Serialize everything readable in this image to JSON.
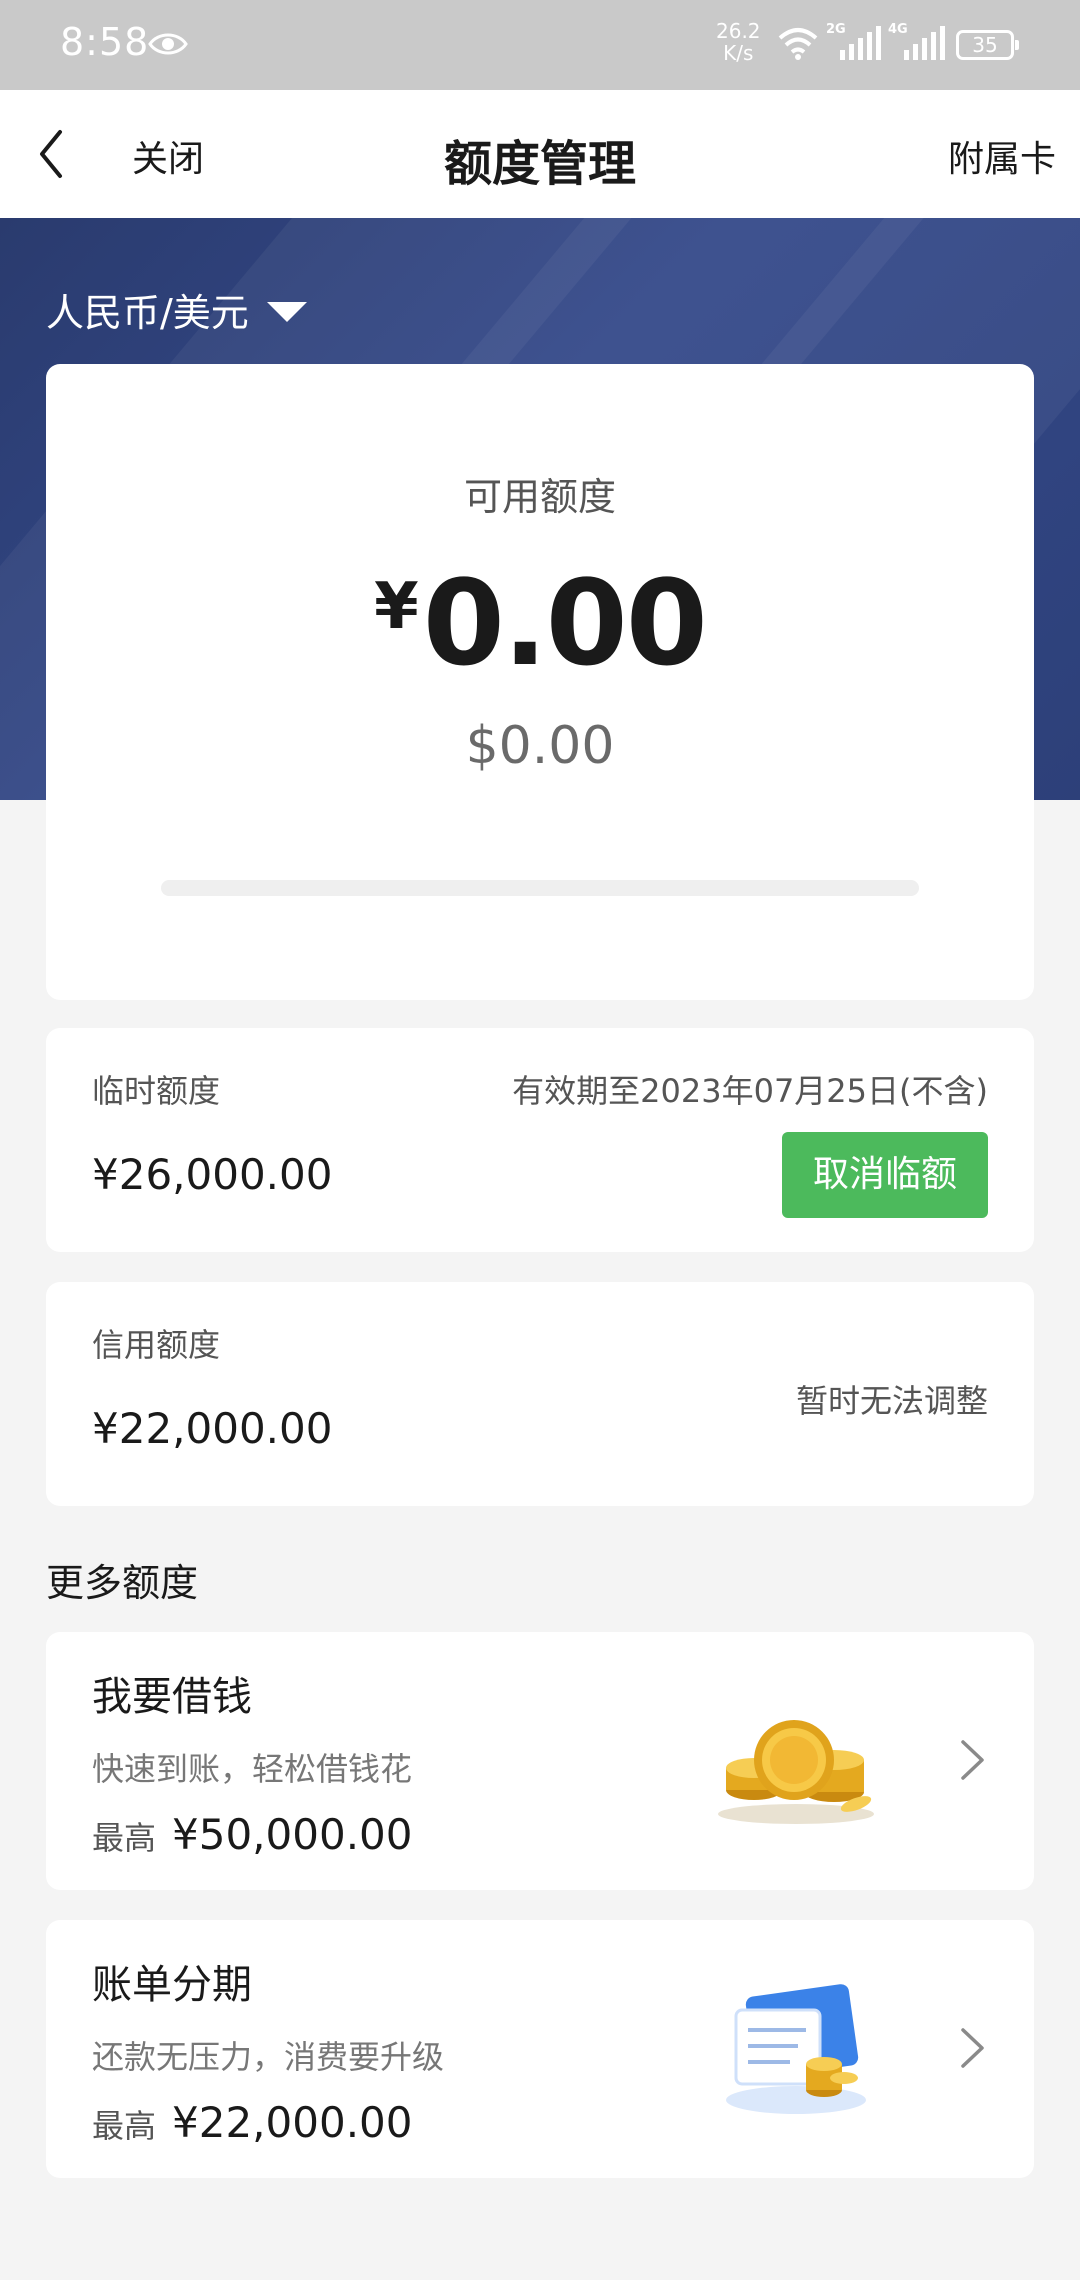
{
  "status_bar": {
    "time": "8:58",
    "net_speed_value": "26.2",
    "net_speed_unit": "K/s",
    "sig1_tag": "2G",
    "sig2_tag": "4G",
    "battery": "35"
  },
  "nav": {
    "close": "关闭",
    "title": "额度管理",
    "right": "附属卡"
  },
  "currency_selector": "人民币/美元",
  "available": {
    "label": "可用额度",
    "symbol": "¥",
    "value": "0.00",
    "usd": "$0.00",
    "usage_fraction": 0
  },
  "temporary": {
    "label": "临时额度",
    "expiry": "有效期至2023年07月25日(不含)",
    "amount": "¥26,000.00",
    "button": "取消临额"
  },
  "credit": {
    "label": "信用额度",
    "amount": "¥22,000.00",
    "note": "暂时无法调整"
  },
  "more": {
    "title": "更多额度",
    "items": [
      {
        "title": "我要借钱",
        "subtitle": "快速到账，轻松借钱花",
        "max_label": "最高",
        "max_value": "¥50,000.00",
        "icon": "gold-coins-icon"
      },
      {
        "title": "账单分期",
        "subtitle": "还款无压力，消费要升级",
        "max_label": "最高",
        "max_value": "¥22,000.00",
        "icon": "bill-card-icon"
      }
    ]
  },
  "colors": {
    "hero": "#2f4380",
    "button_green": "#4cba5c",
    "background": "#f4f4f4"
  }
}
